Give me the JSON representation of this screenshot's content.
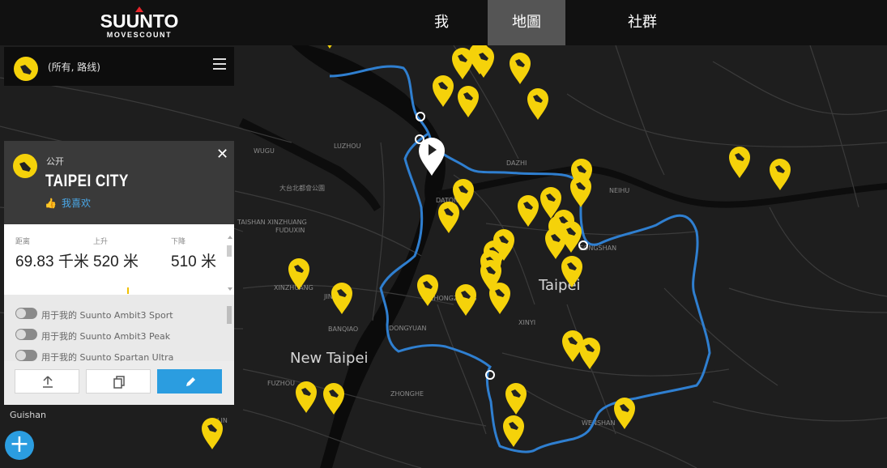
{
  "brand": {
    "name": "SUUNTO",
    "sub": "MOVESCOUNT",
    "accent": "#e8252b"
  },
  "nav": {
    "tabs": [
      {
        "label": "我",
        "active": false
      },
      {
        "label": "地圖",
        "active": true
      },
      {
        "label": "社群",
        "active": false
      }
    ]
  },
  "filter": {
    "label": "(所有, 路线)",
    "icon": "menu-icon"
  },
  "route_card": {
    "visibility": "公开",
    "title": "TAIPEI CITY",
    "like_label": "我喜欢",
    "stats": [
      {
        "label": "距离",
        "value": "69.83 千米"
      },
      {
        "label": "上升",
        "value": "520 米"
      },
      {
        "label": "下降",
        "value": "510 米"
      }
    ],
    "devices": [
      {
        "label": "用于我的 Suunto Ambit3 Sport",
        "enabled": false
      },
      {
        "label": "用于我的 Suunto Ambit3 Peak",
        "enabled": false
      },
      {
        "label": "用于我的 Suunto Spartan Ultra",
        "enabled": false
      }
    ],
    "actions": [
      "upload-icon",
      "copy-icon",
      "edit-icon"
    ]
  },
  "map": {
    "background": "#1e1e1e",
    "route_color": "#2f7fd0",
    "pin_color": "#f5d20a",
    "labels": {
      "new_taipei": "New Taipei",
      "taipei": "Taipei",
      "guishan": "Guishan",
      "luzhou": "LUZHOU",
      "wugu": "WUGU",
      "dazhi": "DAZHI",
      "neihu": "NEIHU",
      "songshan": "SONGSHAN",
      "xinzhuang": "XINZHUANG",
      "xinzhuang2": "XINZHUANG",
      "fuduxin": "FUDUXIN",
      "taishan": "TAISHAN",
      "datong": "DATONG",
      "zhongzheng": "ZHONGZHENG",
      "dongyuan": "DONGYUAN",
      "banqiao": "BANQIAO",
      "xinyi": "XINYI",
      "fuzhou": "FUZHOU",
      "zhonghe": "ZHONGHE",
      "wenshan": "WENSHAN",
      "jinxu": "JINXU",
      "guolin": "LIN",
      "park": "大台北都會公園"
    }
  }
}
